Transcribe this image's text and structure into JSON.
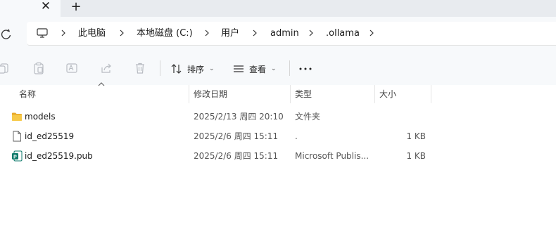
{
  "tabs": {
    "close_glyph": "✕",
    "new_glyph": "+"
  },
  "breadcrumb": {
    "items": [
      "此电脑",
      "本地磁盘 (C:)",
      "用户",
      "admin",
      ".ollama"
    ]
  },
  "toolbar": {
    "sort_label": "排序",
    "view_label": "查看",
    "more_glyph": "•••"
  },
  "columns": {
    "name": "名称",
    "date": "修改日期",
    "type": "类型",
    "size": "大小"
  },
  "files": [
    {
      "name": "models",
      "date": "2025/2/13 周四 20:10",
      "type": "文件夹",
      "size": "",
      "icon": "folder-icon"
    },
    {
      "name": "id_ed25519",
      "date": "2025/2/6 周四 15:11",
      "type": ".",
      "size": "1 KB",
      "icon": "file-icon"
    },
    {
      "name": "id_ed25519.pub",
      "date": "2025/2/6 周四 15:11",
      "type": "Microsoft Publis...",
      "size": "1 KB",
      "icon": "publisher-icon"
    }
  ],
  "colors": {
    "folder": "#f5c342",
    "publisher": "#0e7a6b",
    "chrome": "#f7f9fb",
    "tabstrip": "#e8ebef"
  }
}
